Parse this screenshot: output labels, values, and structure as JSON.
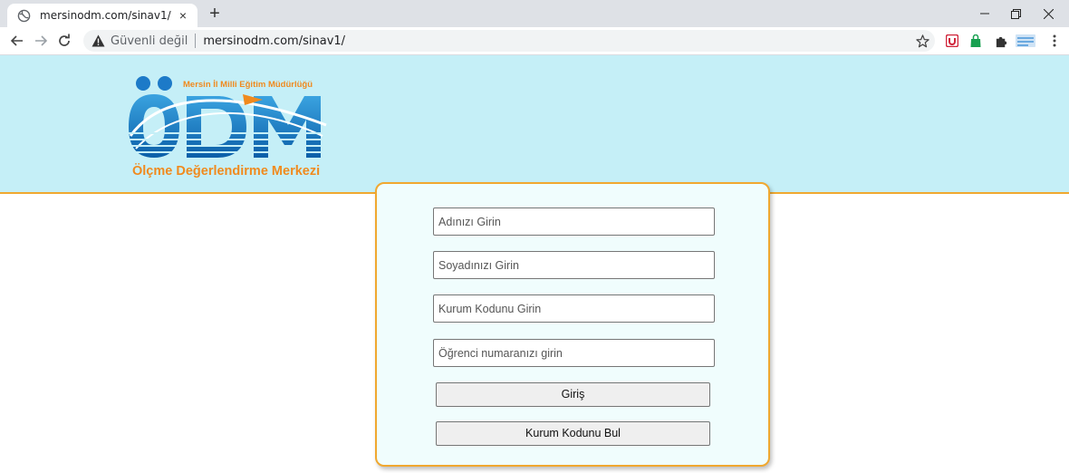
{
  "browser": {
    "tab_title": "mersinodm.com/sinav1/",
    "security_label": "Güvenli değil",
    "url": "mersinodm.com/sinav1/",
    "new_tab_glyph": "+",
    "close_glyph": "×"
  },
  "header": {
    "logo_tagline": "Mersin İl Milli Eğitim Müdürlüğü",
    "logo_subtitle": "Ölçme Değerlendirme Merkezi",
    "background_color": "#c5eff7",
    "accent_color": "#f0a830"
  },
  "form": {
    "first_name_placeholder": "Adınızı Girin",
    "last_name_placeholder": "Soyadınızı Girin",
    "institution_code_placeholder": "Kurum Kodunu Girin",
    "student_number_placeholder": "Öğrenci numaranızı girin",
    "login_button": "Giriş",
    "find_code_button": "Kurum Kodunu Bul"
  },
  "icons": [
    "globe-icon",
    "close-icon",
    "new-tab-icon",
    "minimize-icon",
    "restore-icon",
    "window-close-icon",
    "back-icon",
    "forward-icon",
    "reload-icon",
    "warning-icon",
    "bookmark-star-icon",
    "extension-shield-icon",
    "extension-bag-icon",
    "puzzle-icon",
    "extension-flag-icon",
    "menu-icon"
  ]
}
